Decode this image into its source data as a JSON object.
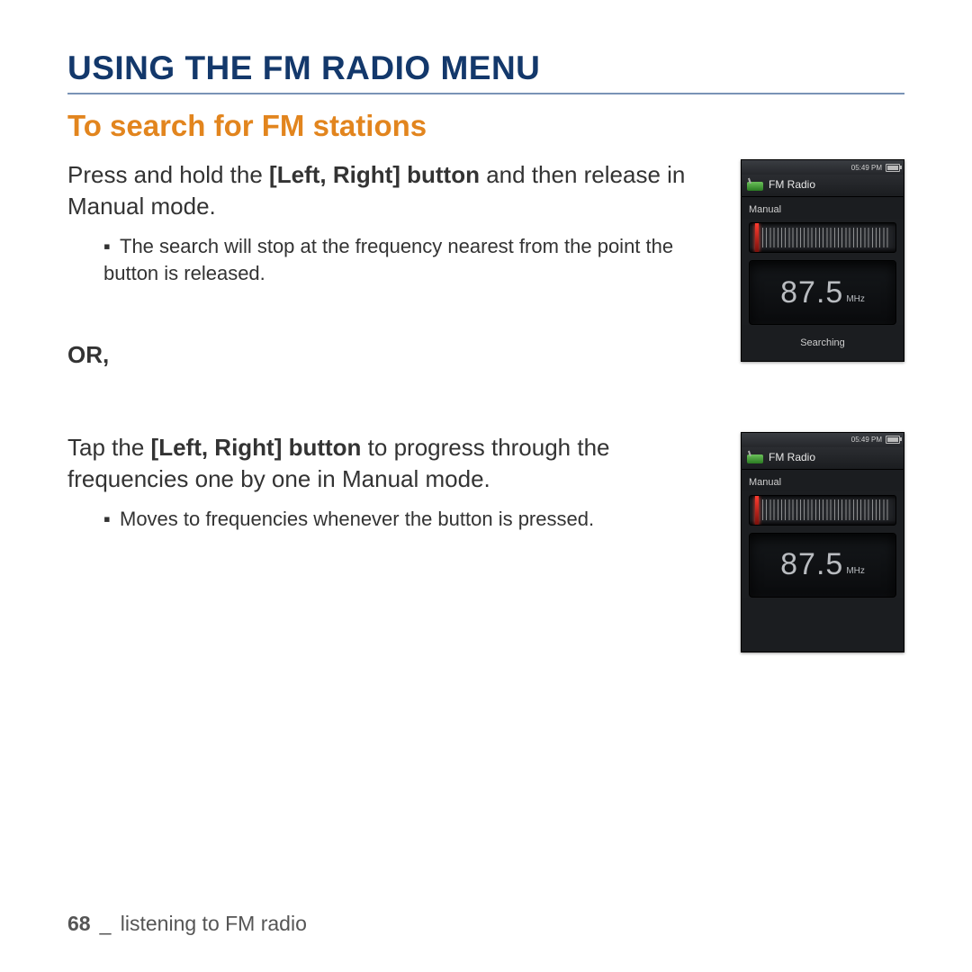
{
  "page": {
    "title": "USING THE FM RADIO MENU",
    "section": "To search for FM stations",
    "footer_page": "68",
    "footer_sep": "_",
    "footer_text": "listening to FM radio"
  },
  "blocks": {
    "hold": {
      "pre": "Press and hold the ",
      "bold": "Left, Right] button",
      "bold_prefix": "[",
      "post": " and then release in Manual mode.",
      "bullet": "The search will stop at the frequency nearest from the point the button is released."
    },
    "or_label": "OR,",
    "tap": {
      "pre": "Tap the ",
      "bold": "Left, Right] button",
      "bold_prefix": "[",
      "post": " to progress through the frequencies one by one in Manual mode.",
      "bullet": "Moves to frequencies whenever the button is pressed."
    }
  },
  "device": {
    "time": "05:49 PM",
    "app_title": "FM Radio",
    "mode": "Manual",
    "frequency": "87.5",
    "unit": "MHz",
    "status_searching": "Searching"
  }
}
